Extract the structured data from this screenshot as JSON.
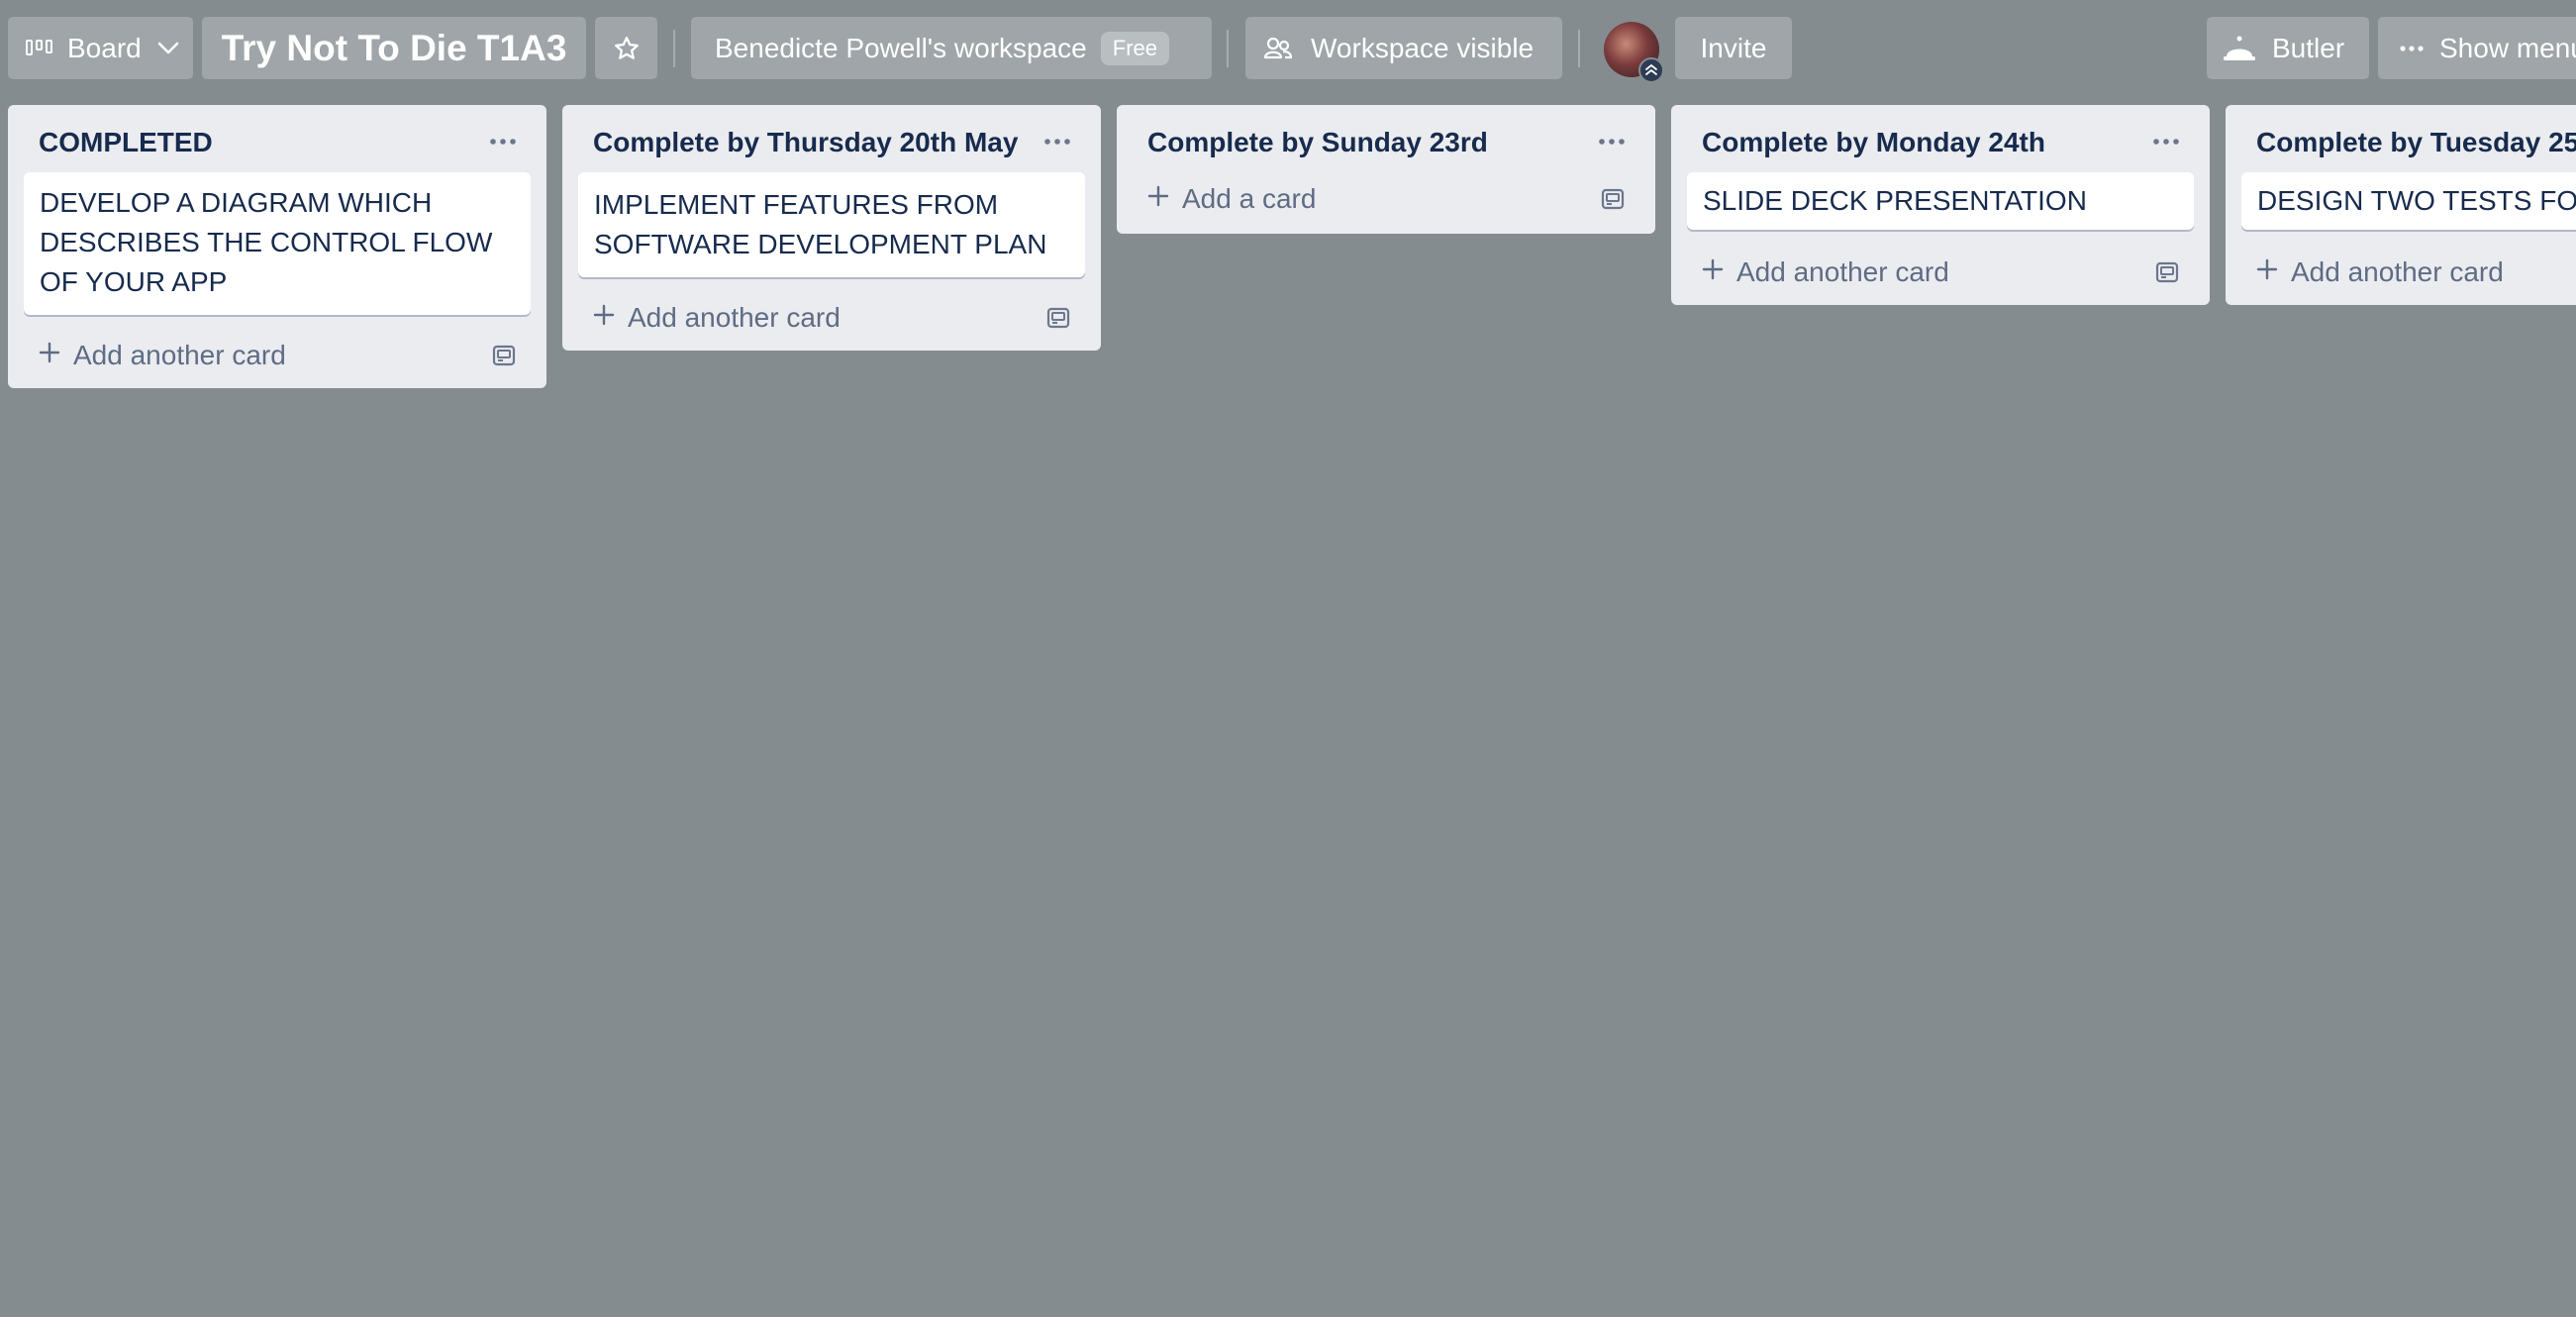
{
  "header": {
    "view_switcher": "Board",
    "board_title": "Try Not To Die T1A3",
    "workspace": "Benedicte Powell's workspace",
    "workspace_plan": "Free",
    "visibility": "Workspace visible",
    "invite": "Invite",
    "butler": "Butler",
    "show_menu": "Show menu"
  },
  "lists": [
    {
      "title": "COMPLETED",
      "cards": [
        "DEVELOP A DIAGRAM WHICH DESCRIBES THE CONTROL FLOW OF YOUR APP"
      ],
      "add_label": "Add another card"
    },
    {
      "title": "Complete by Thursday 20th May",
      "cards": [
        "IMPLEMENT FEATURES FROM SOFTWARE DEVELOPMENT PLAN"
      ],
      "add_label": "Add another card"
    },
    {
      "title": "Complete by Sunday 23rd",
      "cards": [],
      "add_label": "Add a card"
    },
    {
      "title": "Complete by Monday 24th",
      "cards": [
        "SLIDE DECK PRESENTATION"
      ],
      "add_label": "Add another card"
    },
    {
      "title": "Complete by Tuesday 25",
      "cards": [
        "DESIGN TWO TESTS FOR"
      ],
      "add_label": "Add another card"
    }
  ]
}
